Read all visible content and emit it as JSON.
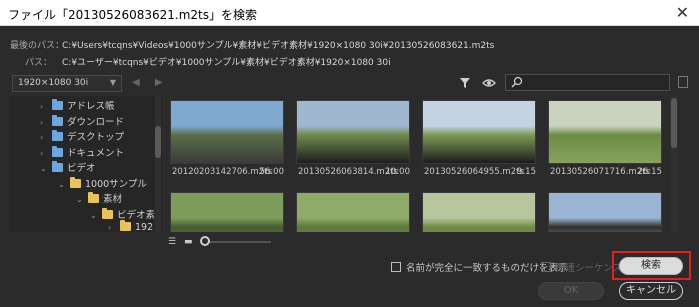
{
  "window": {
    "title": "ファイル「20130526083621.m2ts」を検索",
    "close_glyph": "✕"
  },
  "paths": {
    "last_label": "最後のパス：",
    "last_value": "C:¥Users¥tcqns¥Videos¥1000サンプル¥素材¥ビデオ素材¥1920×1080 30i¥20130526083621.m2ts",
    "path_label": "パス：",
    "path_value": "C:¥ユーザー¥tcqns¥ビデオ¥1000サンプル¥素材¥ビデオ素材¥1920×1080 30i"
  },
  "browser": {
    "resolution_dropdown": "1920×1080 30i",
    "back_forward": "◀ ▶",
    "filter_icon": "funnel-icon",
    "view_icon": "eye-icon",
    "search_icon": "search-icon"
  },
  "tree": {
    "items": [
      {
        "label": "アドレス帳",
        "arrow": "›",
        "icon": "folder-blue"
      },
      {
        "label": "ダウンロード",
        "arrow": "›",
        "icon": "folder-blue"
      },
      {
        "label": "デスクトップ",
        "arrow": "›",
        "icon": "folder-blue"
      },
      {
        "label": "ドキュメント",
        "arrow": "›",
        "icon": "folder-blue"
      },
      {
        "label": "ビデオ",
        "arrow": "⌄",
        "icon": "folder-blue"
      },
      {
        "label": "1000サンプル",
        "arrow": "⌄",
        "icon": "folder"
      },
      {
        "label": "素材",
        "arrow": "⌄",
        "icon": "folder"
      },
      {
        "label": "ビデオ素",
        "arrow": "⌄",
        "icon": "folder"
      },
      {
        "label": "192",
        "arrow": "›",
        "icon": "folder"
      }
    ]
  },
  "files": [
    {
      "name": "20120203142706.m2ts",
      "duration": "56:00",
      "thumb_colors": [
        "#7fa8d0",
        "#5b6e4a",
        "#3b3b3b"
      ]
    },
    {
      "name": "20130526063814.m2ts",
      "duration": "10:00",
      "thumb_colors": [
        "#9fb7cf",
        "#6f8a4e",
        "#1e1e1e"
      ]
    },
    {
      "name": "20130526064955.m2ts",
      "duration": "9:15",
      "thumb_colors": [
        "#c3d3e2",
        "#7d9a55",
        "#1c1c1c"
      ]
    },
    {
      "name": "20130526071716.m2ts",
      "duration": "26:15",
      "thumb_colors": [
        "#c9d3c0",
        "#6b8d44",
        "#8aa060"
      ]
    },
    {
      "name": "",
      "duration": "",
      "thumb_colors": [
        "#7e9c5c",
        "#465c30",
        "#6d7d5a"
      ]
    },
    {
      "name": "",
      "duration": "",
      "thumb_colors": [
        "#8faa6a",
        "#5b7a38",
        "#9a6aa5"
      ]
    },
    {
      "name": "",
      "duration": "",
      "thumb_colors": [
        "#b8c6a0",
        "#6f8a44",
        "#9a6f8f"
      ]
    },
    {
      "name": "",
      "duration": "",
      "thumb_colors": [
        "#9bb4d4",
        "#2e2e2e",
        "#d8d8d8"
      ]
    }
  ],
  "options": {
    "exact_match_label": "名前が完全に一致するものだけを表示",
    "exact_match_checked": false,
    "sequence_label": "関連シーケンス",
    "sequence_enabled": false
  },
  "buttons": {
    "search": "検索",
    "ok": "OK",
    "cancel": "キャンセル"
  },
  "colors": {
    "highlight": "#e02020",
    "folder": "#e8c25a",
    "folder_blue": "#6aa7e0"
  }
}
